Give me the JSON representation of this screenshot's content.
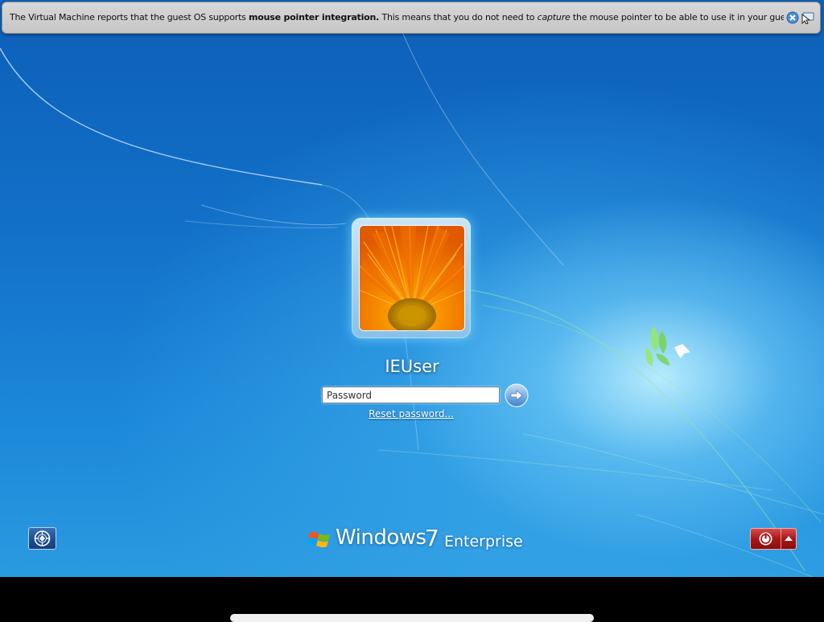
{
  "vm_notice": {
    "text_prefix": "The Virtual Machine reports that the guest OS supports ",
    "text_bold": "mouse pointer integration.",
    "text_middle": " This means that you do not need to ",
    "text_italic": "capture",
    "text_suffix": " the mouse pointer to be able to use it in your guest OS -- all mouse",
    "close_icon": "close-icon",
    "pointer_icon": "mouse-pointer-icon"
  },
  "login": {
    "username": "IEUser",
    "password_placeholder": "Password",
    "submit_icon": "arrow-right-icon",
    "reset_link": "Reset password..."
  },
  "footer": {
    "ease_of_access_icon": "ease-of-access-icon",
    "brand_windows": "Windows",
    "brand_version": "7",
    "brand_edition": "Enterprise",
    "shutdown_icon": "power-icon",
    "shutdown_options_icon": "caret-up-icon"
  },
  "colors": {
    "power_button": "#a81818",
    "background_blue": "#1270c8"
  }
}
